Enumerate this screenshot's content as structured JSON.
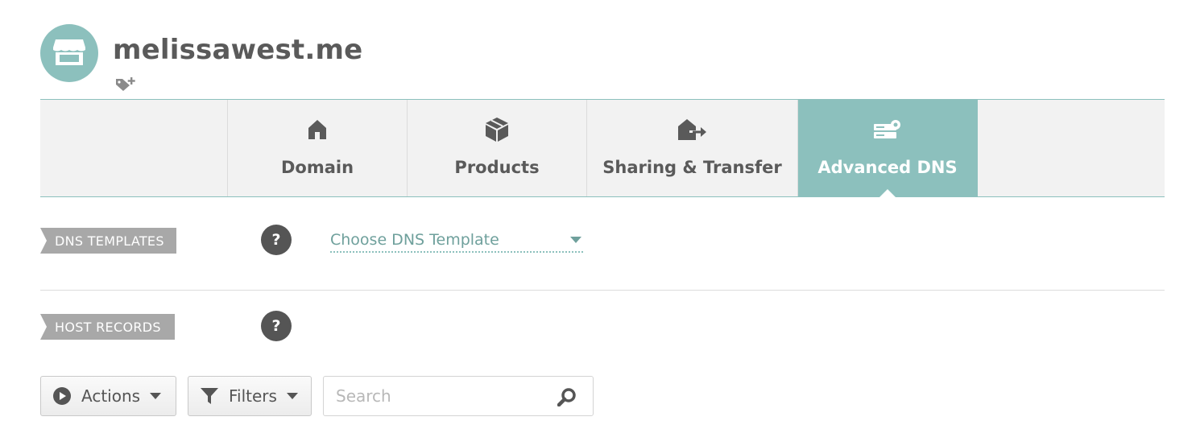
{
  "header": {
    "domain_name": "melissawest.me",
    "avatar_icon": "storefront-icon",
    "tag_icon": "tag-add-icon"
  },
  "tabs": [
    {
      "label": "Domain",
      "icon": "home-icon",
      "active": false
    },
    {
      "label": "Products",
      "icon": "box-icon",
      "active": false
    },
    {
      "label": "Sharing & Transfer",
      "icon": "house-arrow-icon",
      "active": false
    },
    {
      "label": "Advanced DNS",
      "icon": "server-gear-icon",
      "active": true
    }
  ],
  "dns_templates": {
    "label": "DNS TEMPLATES",
    "help": "?",
    "select_value": "Choose DNS Template"
  },
  "host_records": {
    "label": "HOST RECORDS",
    "help": "?"
  },
  "toolbar": {
    "actions_label": "Actions",
    "filters_label": "Filters",
    "search_placeholder": "Search"
  },
  "colors": {
    "accent": "#8cc0bd",
    "ribbon": "#a8a8a8",
    "text": "#5a5a5a",
    "help_bg": "#555555"
  }
}
